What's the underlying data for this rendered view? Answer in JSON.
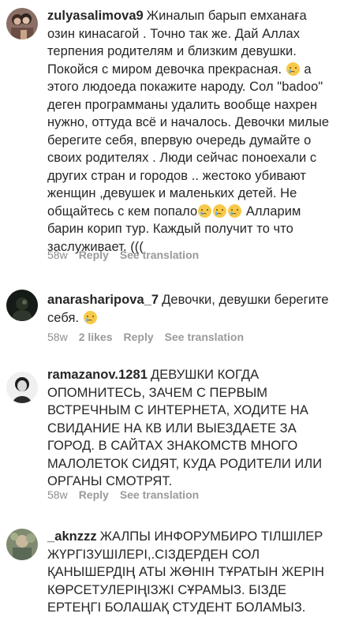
{
  "comments": [
    {
      "username": "zulyasalimova9",
      "avatar_icon": "user-avatar-photo",
      "text_parts": [
        "Жиналып барып емханаға озин кинасагой .  Точно так же.  Дай Аллах терпения родителям и близким девушки. Покойся с миром девочка прекрасная. ",
        " а этого людоеда покажите народу.  Сол \"badoo\" деген программаны удалить вообще нахрен нужно, оттуда всё и началось.  Девочки милые берегите себя, впервую очередь думайте о своих родителях . Люди сейчас поноехали с других стран и городов .. жестоко убивают женщин ,девушек и маленьких детей. Не общайтесь с кем попало",
        " Алларим барин корип тур. Каждый получит то что заслуживает. (((",
        ""
      ],
      "time": "58w",
      "likes": "",
      "reply": "Reply",
      "translate": "See translation"
    },
    {
      "username": "anarasharipova_7",
      "avatar_icon": "user-avatar-photo",
      "text_parts": [
        "Девочки, девушки берегите себя. "
      ],
      "time": "58w",
      "likes": "2 likes",
      "reply": "Reply",
      "translate": "See translation"
    },
    {
      "username": "ramazanov.1281",
      "avatar_icon": "user-avatar-photo",
      "text_parts": [
        "ДЕВУШКИ КОГДА ОПОМНИТЕСЬ, ЗАЧЕМ С ПЕРВЫМ ВСТРЕЧНЫМ С ИНТЕРНЕТА, ХОДИТЕ НА СВИДАНИЕ НА КВ ИЛИ ВЫЕЗДАЕТЕ ЗА ГОРОД. В САЙТАХ ЗНАКОМСТВ МНОГО МАЛОЛЕТОК СИДЯТ, КУДА РОДИТЕЛИ ИЛИ ОРГАНЫ СМОТРЯТ."
      ],
      "time": "58w",
      "likes": "",
      "reply": "Reply",
      "translate": "See translation"
    },
    {
      "username": "_aknzzz",
      "avatar_icon": "user-avatar-photo",
      "text_parts": [
        "ЖАЛПЫ ИНФОРУМБИРО ТІЛШІЛЕР ЖҮРГІЗУШІЛЕРІ,.СІЗДЕРДЕН СОЛ ҚАНЫШЕРДІҢ АТЫ ЖӨНІН ТҰРАТЫН ЖЕРІН КӨРСЕТУЛЕРІҢІЗЖІ СҰРАМЫЗ. БІЗДЕ ЕРТЕҢГІ БОЛАШАҚ СТУДЕНТ БОЛАМЫЗ."
      ]
    }
  ],
  "emoji_name": "crying-face-icon"
}
